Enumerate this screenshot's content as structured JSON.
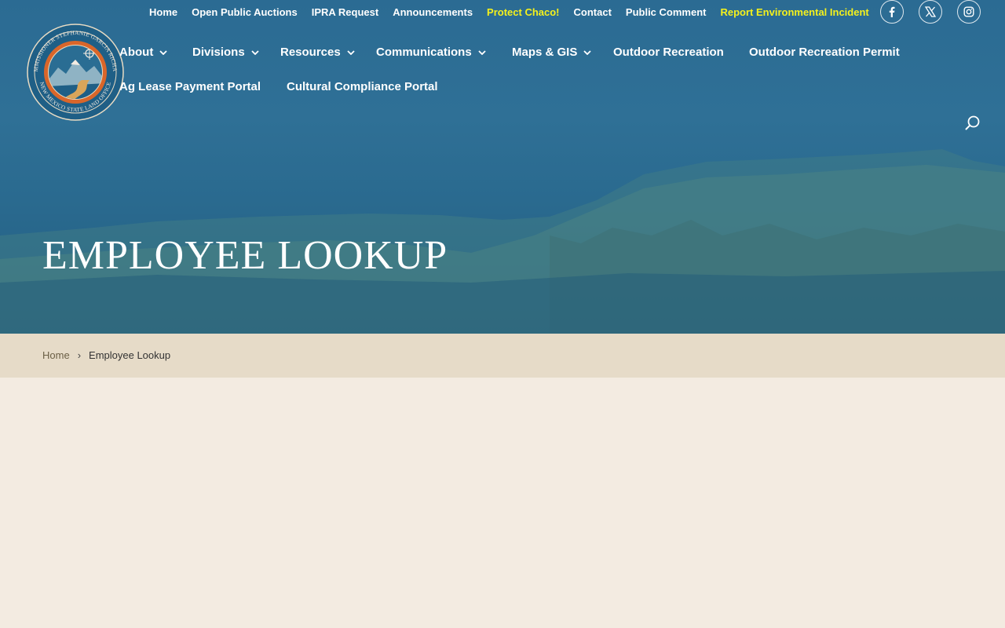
{
  "top_nav": {
    "links": [
      {
        "label": "Home"
      },
      {
        "label": "Open Public Auctions"
      },
      {
        "label": "IPRA Request"
      },
      {
        "label": "Announcements"
      },
      {
        "label": "Protect Chaco!"
      },
      {
        "label": "Contact"
      },
      {
        "label": "Public Comment"
      },
      {
        "label": "Report Environmental Incident"
      }
    ],
    "highlight_color": "#f5f11c"
  },
  "social": {
    "facebook": "facebook-icon",
    "x": "x-icon",
    "instagram": "instagram-icon"
  },
  "logo": {
    "ring_text_top": "COMMISSIONER STEPHANIE GARCIA RICHARD",
    "ring_text_bottom": "NEW MEXICO STATE LAND OFFICE"
  },
  "main_nav": {
    "items": [
      {
        "label": "About",
        "has_dropdown": true
      },
      {
        "label": "Divisions",
        "has_dropdown": true
      },
      {
        "label": "Resources",
        "has_dropdown": true
      },
      {
        "label": "Communications",
        "has_dropdown": true
      },
      {
        "label": "Maps & GIS",
        "has_dropdown": true
      },
      {
        "label": "Outdoor Recreation",
        "has_dropdown": false
      },
      {
        "label": "Outdoor Recreation Permit",
        "has_dropdown": false
      },
      {
        "label": "Ag Lease Payment Portal",
        "has_dropdown": false
      },
      {
        "label": "Cultural Compliance Portal",
        "has_dropdown": false
      }
    ]
  },
  "hero": {
    "title": "EMPLOYEE LOOKUP",
    "overlay_color": "#2b6b93"
  },
  "breadcrumb": {
    "home": "Home",
    "separator": "›",
    "current": "Employee Lookup"
  },
  "colors": {
    "page_bg": "#f3ebe1",
    "breadcrumb_bg": "#e6dbc8",
    "logo_orange": "#d9662a",
    "logo_blue": "#1f5f86"
  }
}
